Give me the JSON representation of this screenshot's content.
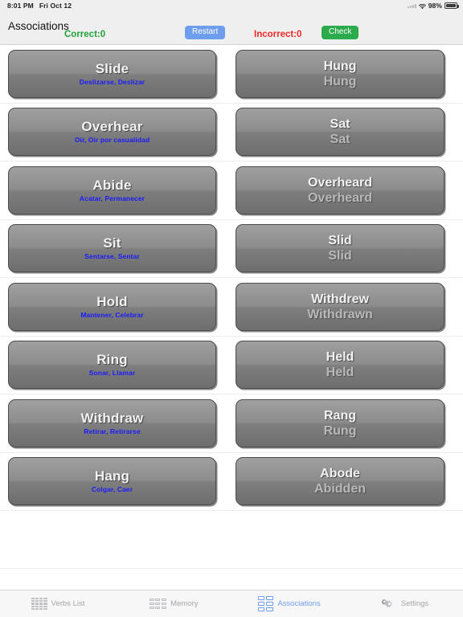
{
  "status_bar": {
    "time": "8:01 PM",
    "date": "Fri Oct 12",
    "battery_percent": "98%",
    "wifi_icon": "wifi-icon",
    "signal_icon": "signal-dots-icon",
    "battery_icon": "battery-icon"
  },
  "header": {
    "title": "Associations",
    "restart_label": "Restart",
    "check_label": "Check",
    "restart_color": "#6f9ded",
    "check_color": "#2bab4b"
  },
  "score": {
    "correct_label": "Correct:0",
    "incorrect_label": "Incorrect:0",
    "correct_color": "#21a03a",
    "incorrect_color": "#f02929"
  },
  "board": {
    "rows": [
      {
        "left": {
          "english": "Slide",
          "spanish": "Deslizarse, Deslizar"
        },
        "right": {
          "past": "Hung",
          "participle": "Hung"
        }
      },
      {
        "left": {
          "english": "Overhear",
          "spanish": "Oir, Oir por casualidad"
        },
        "right": {
          "past": "Sat",
          "participle": "Sat"
        }
      },
      {
        "left": {
          "english": "Abide",
          "spanish": "Acatar, Permanecer"
        },
        "right": {
          "past": "Overheard",
          "participle": "Overheard"
        }
      },
      {
        "left": {
          "english": "Sit",
          "spanish": "Sentarse, Sentar"
        },
        "right": {
          "past": "Slid",
          "participle": "Slid"
        }
      },
      {
        "left": {
          "english": "Hold",
          "spanish": "Mantener, Celebrar"
        },
        "right": {
          "past": "Withdrew",
          "participle": "Withdrawn"
        }
      },
      {
        "left": {
          "english": "Ring",
          "spanish": "Sonar, Llamar"
        },
        "right": {
          "past": "Held",
          "participle": "Held"
        }
      },
      {
        "left": {
          "english": "Withdraw",
          "spanish": "Retirar, Retirarse"
        },
        "right": {
          "past": "Rang",
          "participle": "Rung"
        }
      },
      {
        "left": {
          "english": "Hang",
          "spanish": "Colgar, Caer"
        },
        "right": {
          "past": "Abode",
          "participle": "Abidden"
        }
      }
    ]
  },
  "tabbar": {
    "items": [
      {
        "label": "Verbs List",
        "icon": "verbs-list-icon",
        "active": false
      },
      {
        "label": "Memory",
        "icon": "memory-icon",
        "active": false
      },
      {
        "label": "Associations",
        "icon": "associations-icon",
        "active": true
      },
      {
        "label": "Settings",
        "icon": "settings-gears-icon",
        "active": false
      }
    ],
    "active_color": "#6f9ded",
    "inactive_color": "#a4a4a8"
  }
}
